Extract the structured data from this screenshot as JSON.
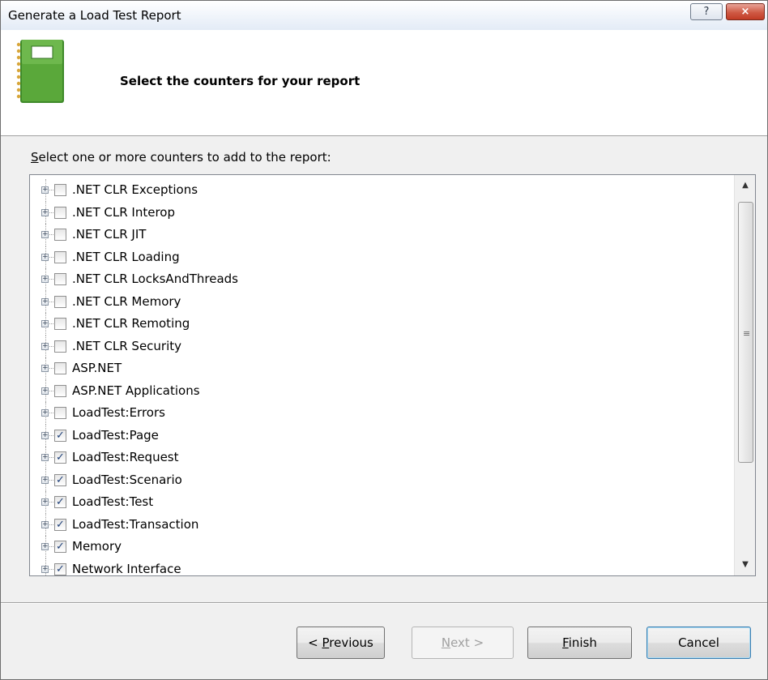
{
  "window": {
    "title": "Generate a Load Test Report",
    "help_glyph": "?",
    "close_glyph": "×"
  },
  "header": {
    "title": "Select the counters for your report"
  },
  "prompt": {
    "prefix": "S",
    "rest": "elect one or more counters to add to the report:"
  },
  "tree": {
    "items": [
      {
        "label": ".NET CLR Exceptions",
        "checked": false
      },
      {
        "label": ".NET CLR Interop",
        "checked": false
      },
      {
        "label": ".NET CLR JIT",
        "checked": false
      },
      {
        "label": ".NET CLR Loading",
        "checked": false
      },
      {
        "label": ".NET CLR LocksAndThreads",
        "checked": false
      },
      {
        "label": ".NET CLR Memory",
        "checked": false
      },
      {
        "label": ".NET CLR Remoting",
        "checked": false
      },
      {
        "label": ".NET CLR Security",
        "checked": false
      },
      {
        "label": "ASP.NET",
        "checked": false
      },
      {
        "label": "ASP.NET Applications",
        "checked": false
      },
      {
        "label": "LoadTest:Errors",
        "checked": false
      },
      {
        "label": "LoadTest:Page",
        "checked": true
      },
      {
        "label": "LoadTest:Request",
        "checked": true
      },
      {
        "label": "LoadTest:Scenario",
        "checked": true
      },
      {
        "label": "LoadTest:Test",
        "checked": true
      },
      {
        "label": "LoadTest:Transaction",
        "checked": true
      },
      {
        "label": "Memory",
        "checked": true
      },
      {
        "label": "Network Interface",
        "checked": true
      }
    ],
    "expander_glyph": "+",
    "check_glyph": "✓"
  },
  "scrollbar": {
    "up_glyph": "▲",
    "down_glyph": "▼",
    "grip_glyph": "≡"
  },
  "buttons": {
    "previous": {
      "before": "< ",
      "access": "P",
      "after": "revious"
    },
    "next": {
      "access": "N",
      "after": "ext >"
    },
    "finish": {
      "access": "F",
      "after": "inish"
    },
    "cancel": "Cancel"
  },
  "colors": {
    "book_green": "#5aa83a",
    "check_color": "#21427a"
  }
}
